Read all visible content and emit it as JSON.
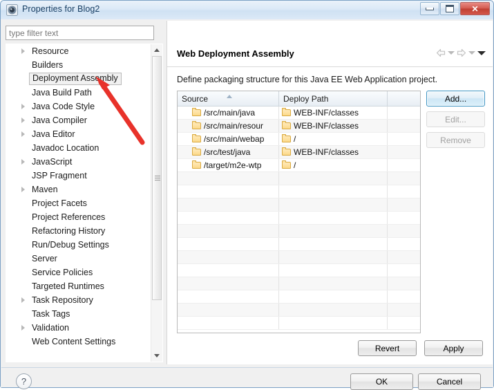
{
  "window": {
    "title": "Properties for Blog2",
    "icon": "eclipse-properties-icon",
    "controls": {
      "minimize": "minimize-icon",
      "maximize": "maximize-icon",
      "close": "✕"
    }
  },
  "sidebar": {
    "filter": {
      "placeholder": "type filter text",
      "value": ""
    },
    "items": [
      {
        "label": "Resource",
        "expandable": true,
        "selected": false
      },
      {
        "label": "Builders",
        "expandable": false,
        "selected": false
      },
      {
        "label": "Deployment Assembly",
        "expandable": false,
        "selected": true
      },
      {
        "label": "Java Build Path",
        "expandable": false,
        "selected": false
      },
      {
        "label": "Java Code Style",
        "expandable": true,
        "selected": false
      },
      {
        "label": "Java Compiler",
        "expandable": true,
        "selected": false
      },
      {
        "label": "Java Editor",
        "expandable": true,
        "selected": false
      },
      {
        "label": "Javadoc Location",
        "expandable": false,
        "selected": false
      },
      {
        "label": "JavaScript",
        "expandable": true,
        "selected": false
      },
      {
        "label": "JSP Fragment",
        "expandable": false,
        "selected": false
      },
      {
        "label": "Maven",
        "expandable": true,
        "selected": false
      },
      {
        "label": "Project Facets",
        "expandable": false,
        "selected": false
      },
      {
        "label": "Project References",
        "expandable": false,
        "selected": false
      },
      {
        "label": "Refactoring History",
        "expandable": false,
        "selected": false
      },
      {
        "label": "Run/Debug Settings",
        "expandable": false,
        "selected": false
      },
      {
        "label": "Server",
        "expandable": false,
        "selected": false
      },
      {
        "label": "Service Policies",
        "expandable": false,
        "selected": false
      },
      {
        "label": "Targeted Runtimes",
        "expandable": false,
        "selected": false
      },
      {
        "label": "Task Repository",
        "expandable": true,
        "selected": false
      },
      {
        "label": "Task Tags",
        "expandable": false,
        "selected": false
      },
      {
        "label": "Validation",
        "expandable": true,
        "selected": false
      },
      {
        "label": "Web Content Settings",
        "expandable": false,
        "selected": false
      }
    ],
    "scrollbar": {
      "up": "scroll-up-arrow",
      "down": "scroll-down-arrow"
    }
  },
  "main": {
    "title": "Web Deployment Assembly",
    "description": "Define packaging structure for this Java EE Web Application project.",
    "nav": {
      "back": "back-arrow-icon",
      "back_menu": "chevron-down-icon",
      "forward": "forward-arrow-icon",
      "forward_menu": "chevron-down-icon",
      "more": "chevron-down-icon"
    },
    "table": {
      "columns": [
        "Source",
        "Deploy Path",
        ""
      ],
      "sorted_column": "Source",
      "rows": [
        {
          "source": "/src/main/java",
          "deploy": "WEB-INF/classes"
        },
        {
          "source": "/src/main/resour",
          "deploy": "WEB-INF/classes"
        },
        {
          "source": "/src/main/webap",
          "deploy": "/"
        },
        {
          "source": "/src/test/java",
          "deploy": "WEB-INF/classes"
        },
        {
          "source": "/target/m2e-wtp",
          "deploy": "/"
        }
      ],
      "empty_row_count": 12
    },
    "buttons": {
      "add": {
        "label": "Add...",
        "enabled": true
      },
      "edit": {
        "label": "Edit...",
        "enabled": false
      },
      "remove": {
        "label": "Remove",
        "enabled": false
      }
    },
    "revert": "Revert",
    "apply": "Apply"
  },
  "footer": {
    "help": "?",
    "ok": "OK",
    "cancel": "Cancel"
  },
  "annotation": {
    "type": "red-arrow",
    "color": "#e8322a",
    "points_at": "Deployment Assembly"
  }
}
